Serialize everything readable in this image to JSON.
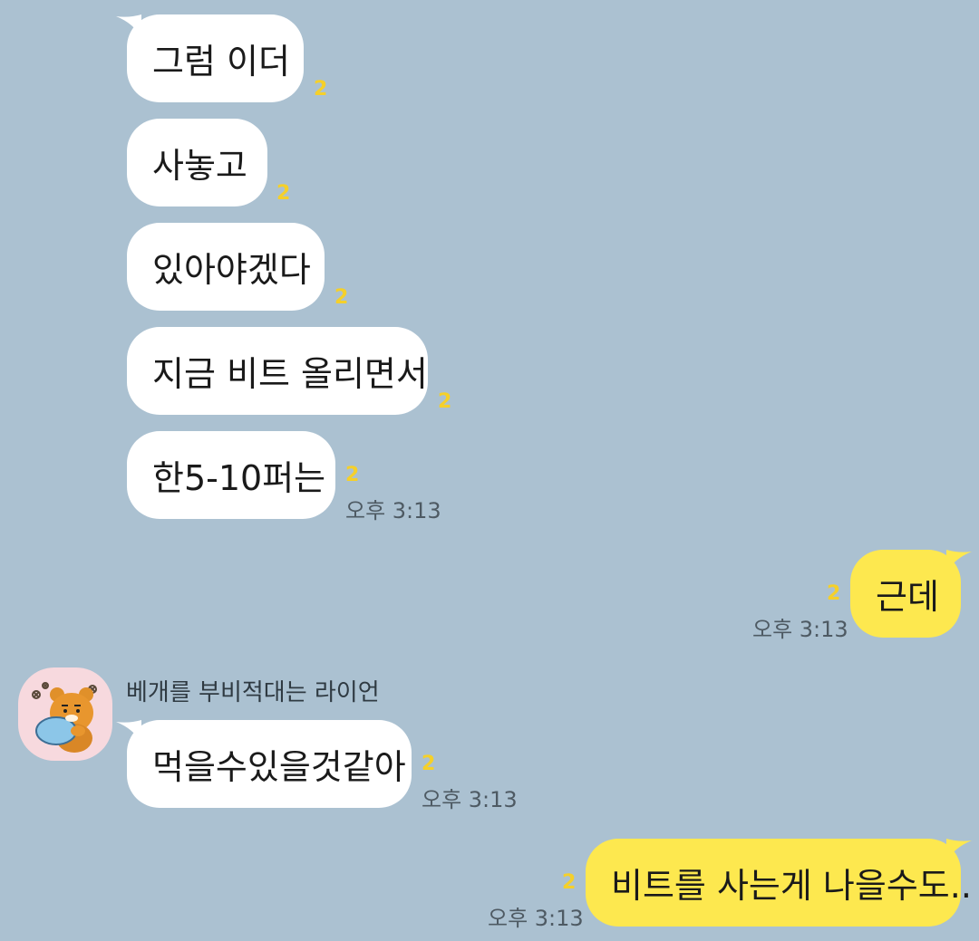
{
  "chat": {
    "messages": [
      {
        "text": "그럼 이더",
        "unread": "2"
      },
      {
        "text": "사놓고",
        "unread": "2"
      },
      {
        "text": "있아야겠다",
        "unread": "2"
      },
      {
        "text": "지금 비트 올리면서",
        "unread": "2"
      },
      {
        "text": "한5-10퍼는",
        "unread": "2",
        "time": "오후 3:13"
      },
      {
        "text": "근데",
        "unread": "2",
        "time": "오후 3:13"
      },
      {
        "text": "먹을수있을것같아",
        "unread": "2",
        "time": "오후 3:13"
      },
      {
        "text": "비트를 사는게 나을수도..",
        "unread": "2",
        "time": "오후 3:13"
      }
    ],
    "sender_name": "베개를 부비적대는 라이언"
  },
  "colors": {
    "background": "#abc1d1",
    "incoming_bubble": "#ffffff",
    "outgoing_bubble": "#fde84f",
    "unread_count": "#f5d02a"
  },
  "icons": {
    "avatar": "ryan-hugging-pillow-sticker"
  }
}
